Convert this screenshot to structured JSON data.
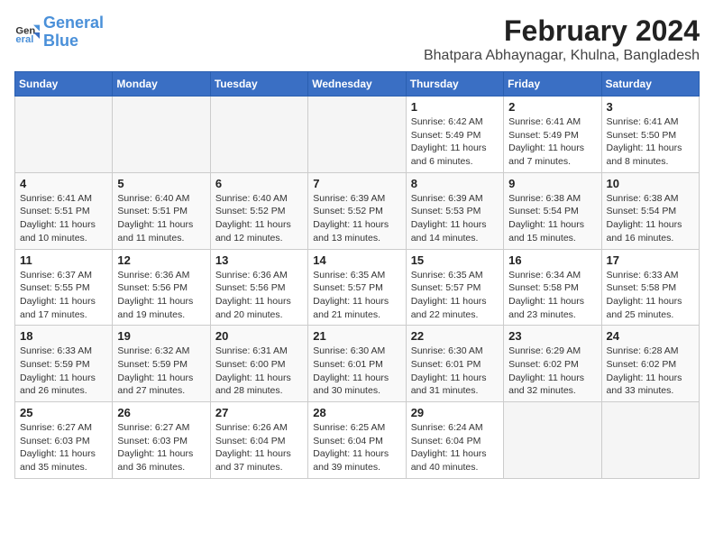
{
  "logo": {
    "line1": "General",
    "line2": "Blue"
  },
  "title": "February 2024",
  "subtitle": "Bhatpara Abhaynagar, Khulna, Bangladesh",
  "headers": [
    "Sunday",
    "Monday",
    "Tuesday",
    "Wednesday",
    "Thursday",
    "Friday",
    "Saturday"
  ],
  "weeks": [
    [
      {
        "day": "",
        "info": ""
      },
      {
        "day": "",
        "info": ""
      },
      {
        "day": "",
        "info": ""
      },
      {
        "day": "",
        "info": ""
      },
      {
        "day": "1",
        "info": "Sunrise: 6:42 AM\nSunset: 5:49 PM\nDaylight: 11 hours\nand 6 minutes."
      },
      {
        "day": "2",
        "info": "Sunrise: 6:41 AM\nSunset: 5:49 PM\nDaylight: 11 hours\nand 7 minutes."
      },
      {
        "day": "3",
        "info": "Sunrise: 6:41 AM\nSunset: 5:50 PM\nDaylight: 11 hours\nand 8 minutes."
      }
    ],
    [
      {
        "day": "4",
        "info": "Sunrise: 6:41 AM\nSunset: 5:51 PM\nDaylight: 11 hours\nand 10 minutes."
      },
      {
        "day": "5",
        "info": "Sunrise: 6:40 AM\nSunset: 5:51 PM\nDaylight: 11 hours\nand 11 minutes."
      },
      {
        "day": "6",
        "info": "Sunrise: 6:40 AM\nSunset: 5:52 PM\nDaylight: 11 hours\nand 12 minutes."
      },
      {
        "day": "7",
        "info": "Sunrise: 6:39 AM\nSunset: 5:52 PM\nDaylight: 11 hours\nand 13 minutes."
      },
      {
        "day": "8",
        "info": "Sunrise: 6:39 AM\nSunset: 5:53 PM\nDaylight: 11 hours\nand 14 minutes."
      },
      {
        "day": "9",
        "info": "Sunrise: 6:38 AM\nSunset: 5:54 PM\nDaylight: 11 hours\nand 15 minutes."
      },
      {
        "day": "10",
        "info": "Sunrise: 6:38 AM\nSunset: 5:54 PM\nDaylight: 11 hours\nand 16 minutes."
      }
    ],
    [
      {
        "day": "11",
        "info": "Sunrise: 6:37 AM\nSunset: 5:55 PM\nDaylight: 11 hours\nand 17 minutes."
      },
      {
        "day": "12",
        "info": "Sunrise: 6:36 AM\nSunset: 5:56 PM\nDaylight: 11 hours\nand 19 minutes."
      },
      {
        "day": "13",
        "info": "Sunrise: 6:36 AM\nSunset: 5:56 PM\nDaylight: 11 hours\nand 20 minutes."
      },
      {
        "day": "14",
        "info": "Sunrise: 6:35 AM\nSunset: 5:57 PM\nDaylight: 11 hours\nand 21 minutes."
      },
      {
        "day": "15",
        "info": "Sunrise: 6:35 AM\nSunset: 5:57 PM\nDaylight: 11 hours\nand 22 minutes."
      },
      {
        "day": "16",
        "info": "Sunrise: 6:34 AM\nSunset: 5:58 PM\nDaylight: 11 hours\nand 23 minutes."
      },
      {
        "day": "17",
        "info": "Sunrise: 6:33 AM\nSunset: 5:58 PM\nDaylight: 11 hours\nand 25 minutes."
      }
    ],
    [
      {
        "day": "18",
        "info": "Sunrise: 6:33 AM\nSunset: 5:59 PM\nDaylight: 11 hours\nand 26 minutes."
      },
      {
        "day": "19",
        "info": "Sunrise: 6:32 AM\nSunset: 5:59 PM\nDaylight: 11 hours\nand 27 minutes."
      },
      {
        "day": "20",
        "info": "Sunrise: 6:31 AM\nSunset: 6:00 PM\nDaylight: 11 hours\nand 28 minutes."
      },
      {
        "day": "21",
        "info": "Sunrise: 6:30 AM\nSunset: 6:01 PM\nDaylight: 11 hours\nand 30 minutes."
      },
      {
        "day": "22",
        "info": "Sunrise: 6:30 AM\nSunset: 6:01 PM\nDaylight: 11 hours\nand 31 minutes."
      },
      {
        "day": "23",
        "info": "Sunrise: 6:29 AM\nSunset: 6:02 PM\nDaylight: 11 hours\nand 32 minutes."
      },
      {
        "day": "24",
        "info": "Sunrise: 6:28 AM\nSunset: 6:02 PM\nDaylight: 11 hours\nand 33 minutes."
      }
    ],
    [
      {
        "day": "25",
        "info": "Sunrise: 6:27 AM\nSunset: 6:03 PM\nDaylight: 11 hours\nand 35 minutes."
      },
      {
        "day": "26",
        "info": "Sunrise: 6:27 AM\nSunset: 6:03 PM\nDaylight: 11 hours\nand 36 minutes."
      },
      {
        "day": "27",
        "info": "Sunrise: 6:26 AM\nSunset: 6:04 PM\nDaylight: 11 hours\nand 37 minutes."
      },
      {
        "day": "28",
        "info": "Sunrise: 6:25 AM\nSunset: 6:04 PM\nDaylight: 11 hours\nand 39 minutes."
      },
      {
        "day": "29",
        "info": "Sunrise: 6:24 AM\nSunset: 6:04 PM\nDaylight: 11 hours\nand 40 minutes."
      },
      {
        "day": "",
        "info": ""
      },
      {
        "day": "",
        "info": ""
      }
    ]
  ]
}
